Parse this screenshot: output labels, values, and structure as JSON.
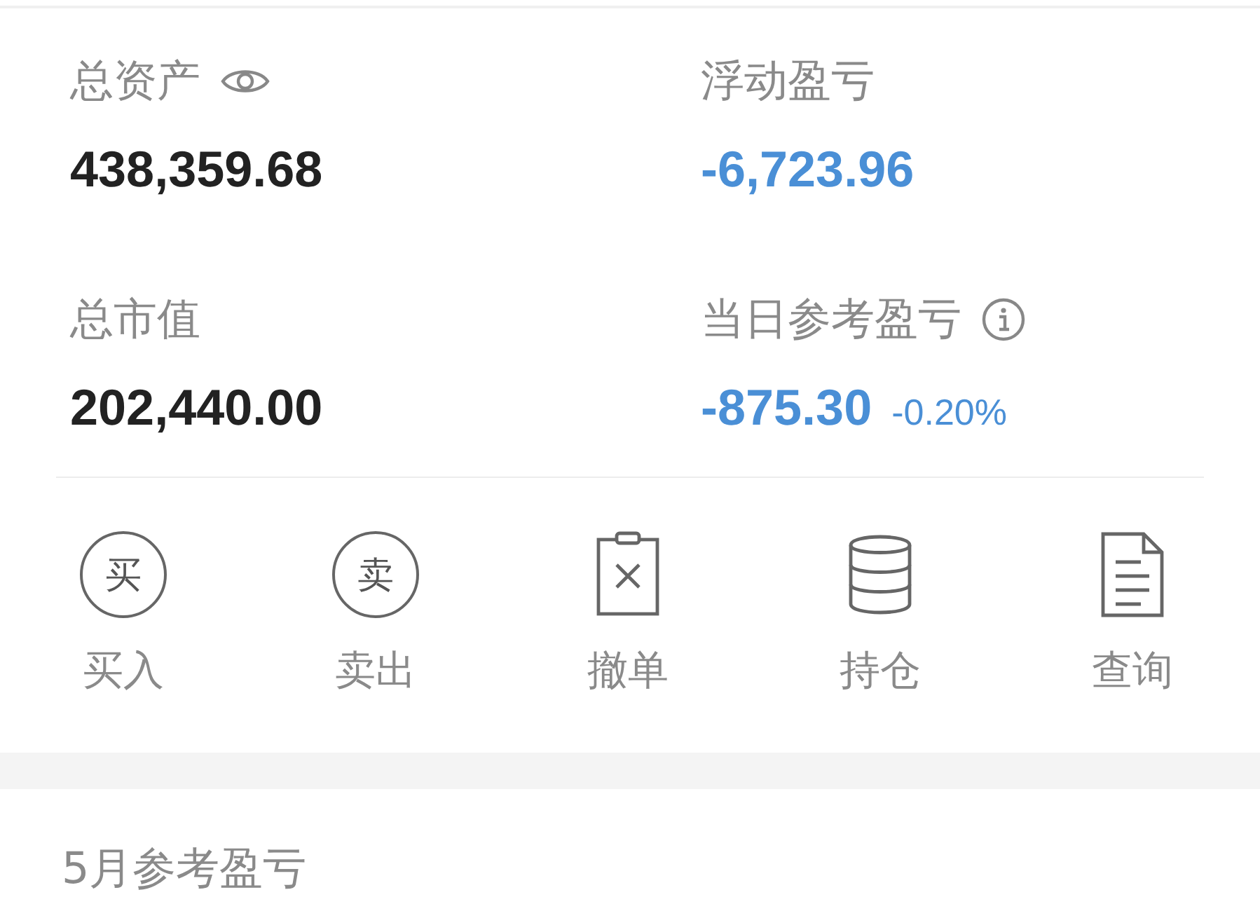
{
  "stats": [
    {
      "kind": "eye",
      "label": "总资产",
      "value": "438,359.68",
      "color": "#222222"
    },
    {
      "kind": "plain",
      "label": "浮动盈亏",
      "value": "-6,723.96",
      "color": "#4a8fd6"
    },
    {
      "kind": "plain",
      "label": "总市值",
      "value": "202,440.00",
      "color": "#222222"
    },
    {
      "kind": "info",
      "label": "当日参考盈亏",
      "value": "-875.30",
      "change": "-0.20%",
      "color": "#4a8fd6"
    }
  ],
  "actions": [
    {
      "kind": "glyph",
      "glyph": "买",
      "label": "买入"
    },
    {
      "kind": "glyph",
      "glyph": "卖",
      "label": "卖出"
    },
    {
      "kind": "cancel",
      "label": "撤单"
    },
    {
      "kind": "database",
      "label": "持仓"
    },
    {
      "kind": "document",
      "label": "查询"
    }
  ],
  "monthly": {
    "title": "5月参考盈亏"
  }
}
